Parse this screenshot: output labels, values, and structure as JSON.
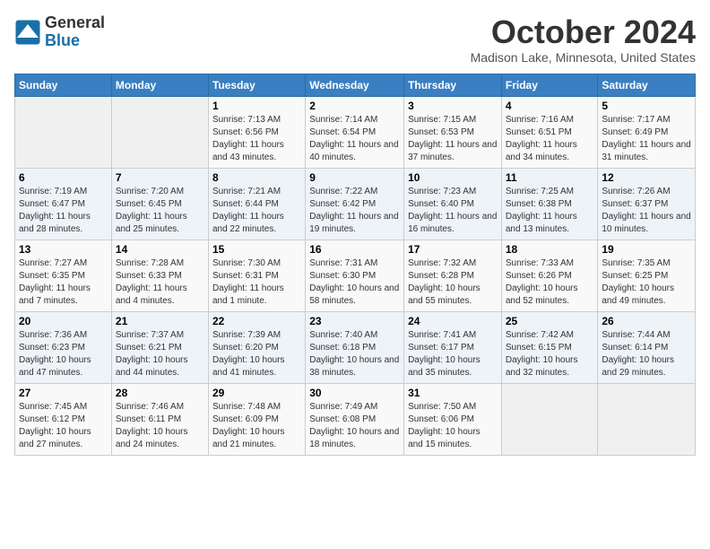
{
  "logo": {
    "general": "General",
    "blue": "Blue"
  },
  "title": "October 2024",
  "location": "Madison Lake, Minnesota, United States",
  "headers": [
    "Sunday",
    "Monday",
    "Tuesday",
    "Wednesday",
    "Thursday",
    "Friday",
    "Saturday"
  ],
  "weeks": [
    [
      {
        "day": "",
        "info": ""
      },
      {
        "day": "",
        "info": ""
      },
      {
        "day": "1",
        "info": "Sunrise: 7:13 AM\nSunset: 6:56 PM\nDaylight: 11 hours and 43 minutes."
      },
      {
        "day": "2",
        "info": "Sunrise: 7:14 AM\nSunset: 6:54 PM\nDaylight: 11 hours and 40 minutes."
      },
      {
        "day": "3",
        "info": "Sunrise: 7:15 AM\nSunset: 6:53 PM\nDaylight: 11 hours and 37 minutes."
      },
      {
        "day": "4",
        "info": "Sunrise: 7:16 AM\nSunset: 6:51 PM\nDaylight: 11 hours and 34 minutes."
      },
      {
        "day": "5",
        "info": "Sunrise: 7:17 AM\nSunset: 6:49 PM\nDaylight: 11 hours and 31 minutes."
      }
    ],
    [
      {
        "day": "6",
        "info": "Sunrise: 7:19 AM\nSunset: 6:47 PM\nDaylight: 11 hours and 28 minutes."
      },
      {
        "day": "7",
        "info": "Sunrise: 7:20 AM\nSunset: 6:45 PM\nDaylight: 11 hours and 25 minutes."
      },
      {
        "day": "8",
        "info": "Sunrise: 7:21 AM\nSunset: 6:44 PM\nDaylight: 11 hours and 22 minutes."
      },
      {
        "day": "9",
        "info": "Sunrise: 7:22 AM\nSunset: 6:42 PM\nDaylight: 11 hours and 19 minutes."
      },
      {
        "day": "10",
        "info": "Sunrise: 7:23 AM\nSunset: 6:40 PM\nDaylight: 11 hours and 16 minutes."
      },
      {
        "day": "11",
        "info": "Sunrise: 7:25 AM\nSunset: 6:38 PM\nDaylight: 11 hours and 13 minutes."
      },
      {
        "day": "12",
        "info": "Sunrise: 7:26 AM\nSunset: 6:37 PM\nDaylight: 11 hours and 10 minutes."
      }
    ],
    [
      {
        "day": "13",
        "info": "Sunrise: 7:27 AM\nSunset: 6:35 PM\nDaylight: 11 hours and 7 minutes."
      },
      {
        "day": "14",
        "info": "Sunrise: 7:28 AM\nSunset: 6:33 PM\nDaylight: 11 hours and 4 minutes."
      },
      {
        "day": "15",
        "info": "Sunrise: 7:30 AM\nSunset: 6:31 PM\nDaylight: 11 hours and 1 minute."
      },
      {
        "day": "16",
        "info": "Sunrise: 7:31 AM\nSunset: 6:30 PM\nDaylight: 10 hours and 58 minutes."
      },
      {
        "day": "17",
        "info": "Sunrise: 7:32 AM\nSunset: 6:28 PM\nDaylight: 10 hours and 55 minutes."
      },
      {
        "day": "18",
        "info": "Sunrise: 7:33 AM\nSunset: 6:26 PM\nDaylight: 10 hours and 52 minutes."
      },
      {
        "day": "19",
        "info": "Sunrise: 7:35 AM\nSunset: 6:25 PM\nDaylight: 10 hours and 49 minutes."
      }
    ],
    [
      {
        "day": "20",
        "info": "Sunrise: 7:36 AM\nSunset: 6:23 PM\nDaylight: 10 hours and 47 minutes."
      },
      {
        "day": "21",
        "info": "Sunrise: 7:37 AM\nSunset: 6:21 PM\nDaylight: 10 hours and 44 minutes."
      },
      {
        "day": "22",
        "info": "Sunrise: 7:39 AM\nSunset: 6:20 PM\nDaylight: 10 hours and 41 minutes."
      },
      {
        "day": "23",
        "info": "Sunrise: 7:40 AM\nSunset: 6:18 PM\nDaylight: 10 hours and 38 minutes."
      },
      {
        "day": "24",
        "info": "Sunrise: 7:41 AM\nSunset: 6:17 PM\nDaylight: 10 hours and 35 minutes."
      },
      {
        "day": "25",
        "info": "Sunrise: 7:42 AM\nSunset: 6:15 PM\nDaylight: 10 hours and 32 minutes."
      },
      {
        "day": "26",
        "info": "Sunrise: 7:44 AM\nSunset: 6:14 PM\nDaylight: 10 hours and 29 minutes."
      }
    ],
    [
      {
        "day": "27",
        "info": "Sunrise: 7:45 AM\nSunset: 6:12 PM\nDaylight: 10 hours and 27 minutes."
      },
      {
        "day": "28",
        "info": "Sunrise: 7:46 AM\nSunset: 6:11 PM\nDaylight: 10 hours and 24 minutes."
      },
      {
        "day": "29",
        "info": "Sunrise: 7:48 AM\nSunset: 6:09 PM\nDaylight: 10 hours and 21 minutes."
      },
      {
        "day": "30",
        "info": "Sunrise: 7:49 AM\nSunset: 6:08 PM\nDaylight: 10 hours and 18 minutes."
      },
      {
        "day": "31",
        "info": "Sunrise: 7:50 AM\nSunset: 6:06 PM\nDaylight: 10 hours and 15 minutes."
      },
      {
        "day": "",
        "info": ""
      },
      {
        "day": "",
        "info": ""
      }
    ]
  ]
}
